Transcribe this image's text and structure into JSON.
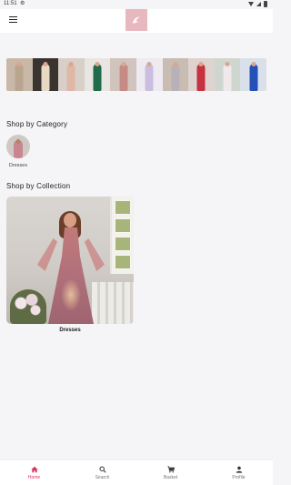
{
  "status_bar": {
    "time": "11:51"
  },
  "header": {
    "menu_icon": "hamburger-menu-icon",
    "logo_icon": "brand-logo"
  },
  "banner": {
    "tiles": [
      {
        "bg": "#c9b7a8",
        "dress": "#b9a48f"
      },
      {
        "bg": "#3a3430",
        "dress": "#e8d8c4"
      },
      {
        "bg": "#d8cfc8",
        "dress": "#e0b7a6"
      },
      {
        "bg": "#e9e5e2",
        "dress": "#1f6b4a"
      },
      {
        "bg": "#d0c4bc",
        "dress": "#c58b84"
      },
      {
        "bg": "#eeeaf2",
        "dress": "#c9bde0"
      },
      {
        "bg": "#c8bcb3",
        "dress": "#b8b2b8"
      },
      {
        "bg": "#ded3ce",
        "dress": "#c6323f"
      },
      {
        "bg": "#cfd6cf",
        "dress": "#efe9ec"
      },
      {
        "bg": "#d9e0ea",
        "dress": "#2450b8"
      }
    ]
  },
  "sections": {
    "category_title": "Shop by Category",
    "collection_title": "Shop by Collection"
  },
  "categories": [
    {
      "label": "Dresses"
    }
  ],
  "collections": [
    {
      "label": "Dresses"
    }
  ],
  "bottom_nav": {
    "items": [
      {
        "label": "Home",
        "icon": "home-icon",
        "active": true
      },
      {
        "label": "Search",
        "icon": "search-icon",
        "active": false
      },
      {
        "label": "Basket",
        "icon": "basket-icon",
        "active": false
      },
      {
        "label": "Profile",
        "icon": "profile-icon",
        "active": false
      }
    ],
    "active_color": "#e0315b"
  }
}
